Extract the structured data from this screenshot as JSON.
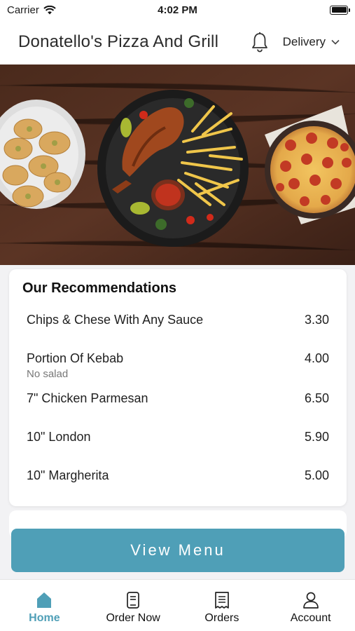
{
  "status_bar": {
    "carrier": "Carrier",
    "time": "4:02 PM"
  },
  "header": {
    "title": "Donatello's Pizza And Grill",
    "delivery_label": "Delivery"
  },
  "recommendations": {
    "title": "Our Recommendations",
    "items": [
      {
        "name": "Chips & Chese With Any Sauce",
        "note": "",
        "price": "3.30"
      },
      {
        "name": "Portion Of Kebab",
        "note": "No salad",
        "price": "4.00"
      },
      {
        "name": "7\" Chicken Parmesan",
        "note": "",
        "price": "6.50"
      },
      {
        "name": "10\" London",
        "note": "",
        "price": "5.90"
      },
      {
        "name": "10\" Margherita",
        "note": "",
        "price": "5.00"
      }
    ]
  },
  "view_menu_label": "View Menu",
  "tabs": [
    {
      "label": "Home",
      "icon": "home-icon",
      "active": true
    },
    {
      "label": "Order Now",
      "icon": "order-now-icon",
      "active": false
    },
    {
      "label": "Orders",
      "icon": "orders-receipt-icon",
      "active": false
    },
    {
      "label": "Account",
      "icon": "account-person-icon",
      "active": false
    }
  ],
  "colors": {
    "accent": "#4f9fb7",
    "background": "#f2f2f4"
  }
}
